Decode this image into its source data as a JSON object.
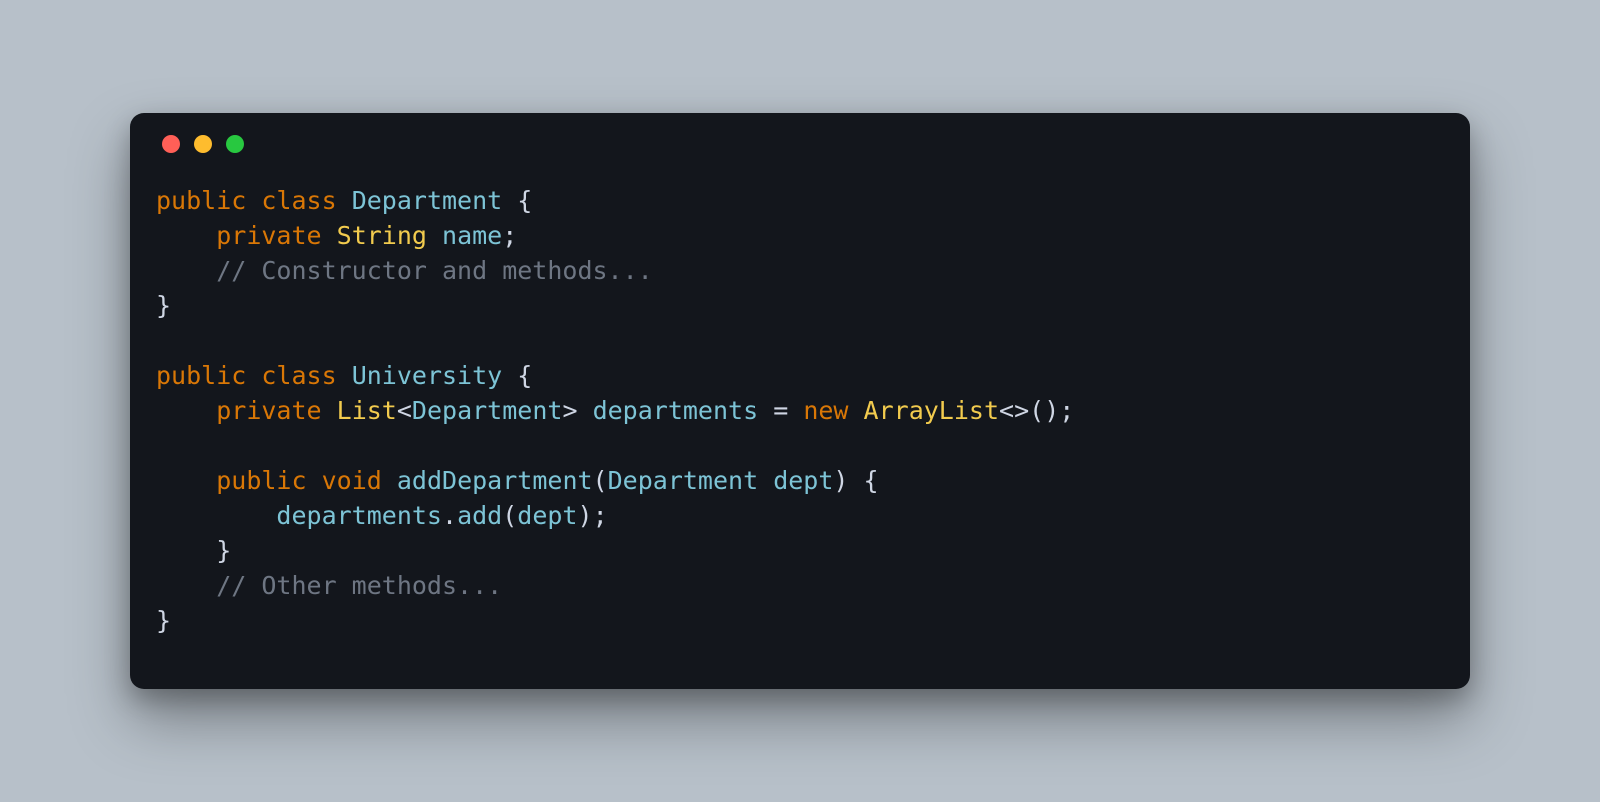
{
  "traffic_lights": {
    "red": "#ff5f57",
    "yellow": "#febc2e",
    "green": "#28c840"
  },
  "colors": {
    "background_page": "#b7c0c9",
    "background_window": "#13161c",
    "keyword": "#d97706",
    "type": "#f2cb4e",
    "identifier": "#7dc4d6",
    "punctuation": "#cfd6e4",
    "comment": "#6e7683"
  },
  "code": {
    "language": "java",
    "tokens": {
      "kw_public": "public",
      "kw_class": "class",
      "dept_class": "Department",
      "brace_open": "{",
      "kw_private": "private",
      "type_string": "String",
      "field_name": "name",
      "semicolon": ";",
      "cmnt_ctor": "// Constructor and methods...",
      "brace_close": "}",
      "uni_class": "University",
      "type_list": "List",
      "angle_open": "<",
      "angle_close": ">",
      "field_depts": "departments",
      "op_assign": "=",
      "kw_new": "new",
      "type_arraylist": "ArrayList",
      "diamond": "<>",
      "paren_open": "(",
      "paren_close": ")",
      "kw_void": "void",
      "method_add_dept": "addDepartment",
      "param_dept": "dept",
      "dot": ".",
      "method_add": "add",
      "cmnt_other": "// Other methods..."
    }
  }
}
